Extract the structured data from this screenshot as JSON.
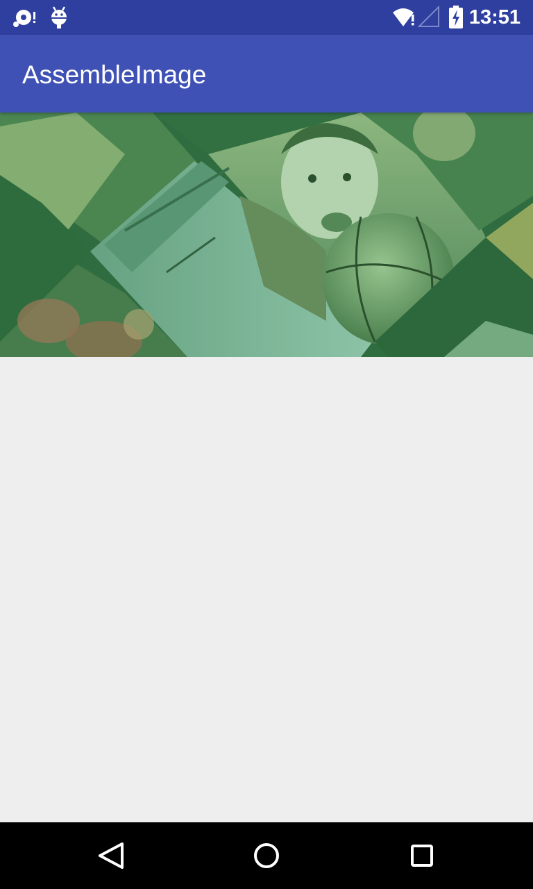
{
  "status_bar": {
    "time": "13:51",
    "icons": [
      "sync-icon",
      "android-debug-icon",
      "wifi-alert-icon",
      "cell-signal-icon",
      "battery-charging-icon"
    ]
  },
  "app_bar": {
    "title": "AssembleImage"
  },
  "banner": {
    "description_icon": "assembled-photo-collage",
    "tint_color": "#2e7d45"
  },
  "nav_bar": {
    "buttons": [
      "back-icon",
      "home-icon",
      "recents-icon"
    ]
  }
}
